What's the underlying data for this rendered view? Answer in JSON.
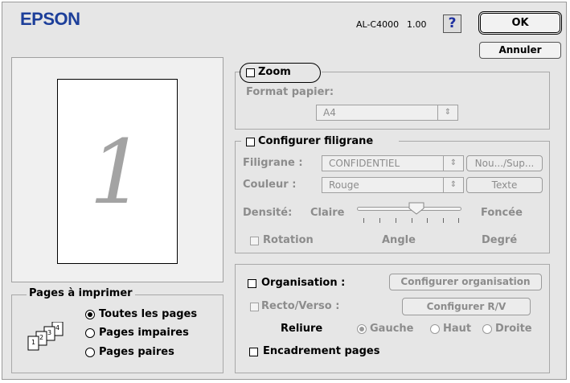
{
  "header": {
    "brand": "EPSON",
    "model": "AL-C4000",
    "version": "1.00",
    "help_label": "?",
    "ok_label": "OK",
    "cancel_label": "Annuler"
  },
  "preview": {
    "page_number": "1"
  },
  "pages_group": {
    "title": "Pages à imprimer",
    "options": [
      "Toutes les pages",
      "Pages impaires",
      "Pages paires"
    ],
    "selected_index": 0,
    "icon_digits": [
      "1",
      "2",
      "3",
      "4"
    ]
  },
  "zoom_group": {
    "label": "Zoom",
    "checked": false,
    "format_label": "Format papier:",
    "format_value": "A4",
    "popup_arrows": "⇕"
  },
  "watermark_group": {
    "label": "Configurer filigrane",
    "checked": false,
    "filigrane_label": "Filigrane :",
    "filigrane_value": "CONFIDENTIEL",
    "new_del_label": "Nou.../Sup...",
    "couleur_label": "Couleur :",
    "couleur_value": "Rouge",
    "texte_label": "Texte",
    "densite_label": "Densité:",
    "claire_label": "Claire",
    "foncee_label": "Foncée",
    "density_level": 0.55,
    "rotation_label": "Rotation",
    "angle_label": "Angle",
    "degre_label": "Degré"
  },
  "layout_group": {
    "organisation_label": "Organisation :",
    "configurer_organisation_label": "Configurer organisation",
    "recto_verso_label": "Recto/Verso :",
    "configurer_rv_label": "Configurer R/V",
    "reliure_label": "Reliure",
    "binding_options": [
      "Gauche",
      "Haut",
      "Droite"
    ],
    "binding_selected_index": 0,
    "encadrement_label": "Encadrement pages"
  }
}
